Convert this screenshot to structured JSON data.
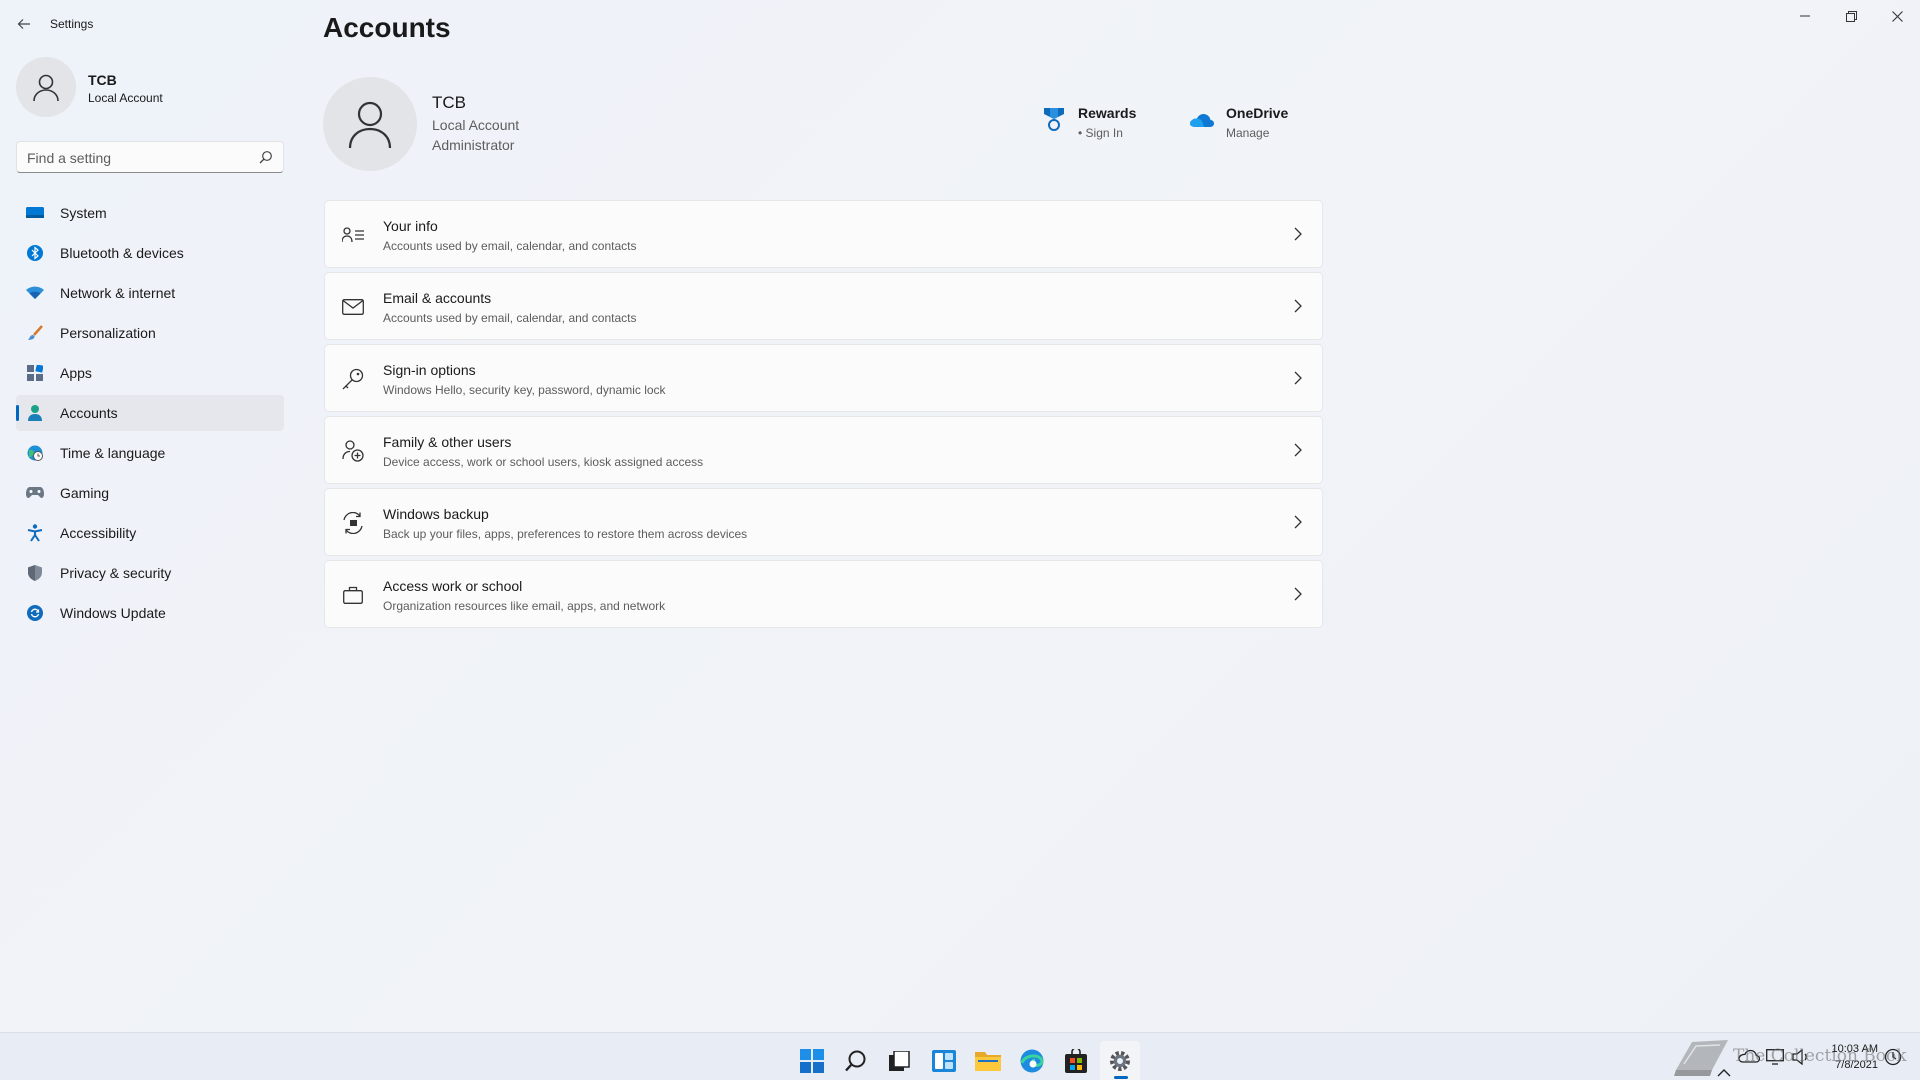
{
  "app": {
    "title": "Settings"
  },
  "account_mini": {
    "name": "TCB",
    "type": "Local Account"
  },
  "search": {
    "placeholder": "Find a setting"
  },
  "sidebar": {
    "items": [
      {
        "label": "System",
        "icon": "monitor-icon"
      },
      {
        "label": "Bluetooth & devices",
        "icon": "bluetooth-icon"
      },
      {
        "label": "Network & internet",
        "icon": "wifi-icon"
      },
      {
        "label": "Personalization",
        "icon": "brush-icon"
      },
      {
        "label": "Apps",
        "icon": "apps-icon"
      },
      {
        "label": "Accounts",
        "icon": "person-icon",
        "active": true
      },
      {
        "label": "Time & language",
        "icon": "globe-clock-icon"
      },
      {
        "label": "Gaming",
        "icon": "gamepad-icon"
      },
      {
        "label": "Accessibility",
        "icon": "accessibility-icon"
      },
      {
        "label": "Privacy & security",
        "icon": "shield-icon"
      },
      {
        "label": "Windows Update",
        "icon": "update-icon"
      }
    ]
  },
  "main": {
    "title": "Accounts",
    "user": {
      "name": "TCB",
      "type": "Local Account",
      "role": "Administrator"
    },
    "services": {
      "rewards": {
        "title": "Rewards",
        "sub": "• Sign In"
      },
      "onedrive": {
        "title": "OneDrive",
        "sub": "Manage"
      }
    },
    "cards": [
      {
        "title": "Your info",
        "sub": "Accounts used by email, calendar, and contacts",
        "icon": "contact-card-icon"
      },
      {
        "title": "Email & accounts",
        "sub": "Accounts used by email, calendar, and contacts",
        "icon": "mail-icon"
      },
      {
        "title": "Sign-in options",
        "sub": "Windows Hello, security key, password, dynamic lock",
        "icon": "key-icon"
      },
      {
        "title": "Family & other users",
        "sub": "Device access, work or school users, kiosk assigned access",
        "icon": "people-add-icon"
      },
      {
        "title": "Windows backup",
        "sub": "Back up your files, apps, preferences to restore them across devices",
        "icon": "backup-icon"
      },
      {
        "title": "Access work or school",
        "sub": "Organization resources like email, apps, and network",
        "icon": "briefcase-icon"
      }
    ]
  },
  "taskbar": {
    "clock_time": "10:03 AM",
    "clock_date": "7/8/2021",
    "watermark": "The Collection Book"
  },
  "colors": {
    "accent": "#0067c0",
    "background": "#eef2f8"
  }
}
